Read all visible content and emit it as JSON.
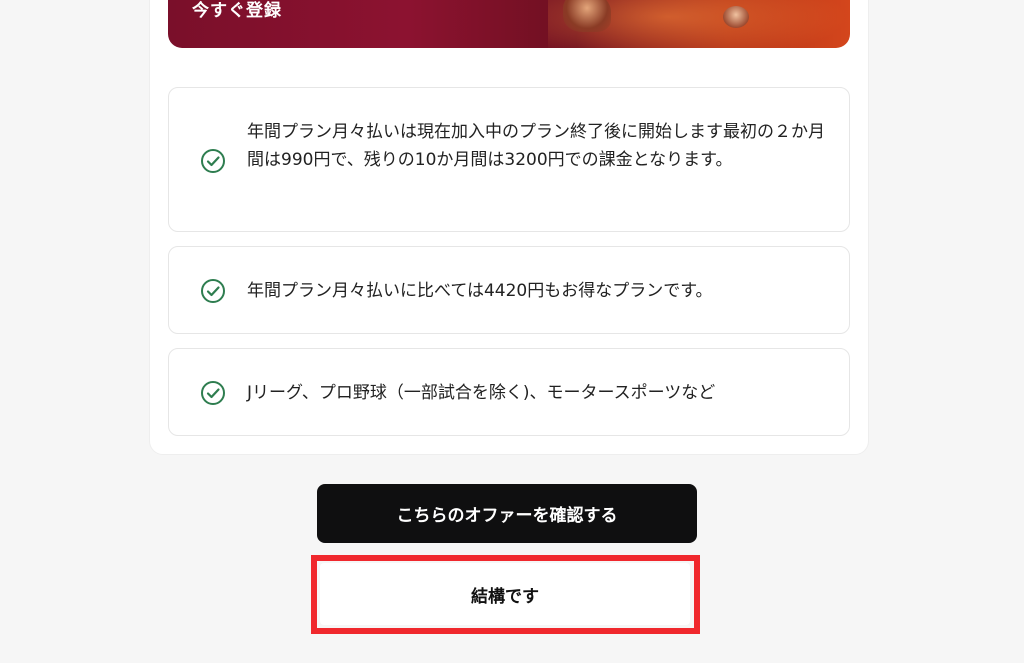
{
  "hero": {
    "register_label": "今すぐ登録"
  },
  "features": [
    {
      "icon": "check-circle-icon",
      "text": "年間プラン月々払いは現在加入中のプラン終了後に開始します最初の２か月間は990円で、残りの10か月間は3200円での課金となります。"
    },
    {
      "icon": "check-circle-icon",
      "text": "年間プラン月々払いに比べては4420円もお得なプランです。"
    },
    {
      "icon": "check-circle-icon",
      "text": "Jリーグ、プロ野球（一部試合を除く)、モータースポーツなど"
    }
  ],
  "actions": {
    "confirm_offer_label": "こちらのオファーを確認する",
    "decline_label": "結構です"
  },
  "colors": {
    "check": "#2e7d4f",
    "primary_button": "#0f0f10",
    "highlight": "#f0282d"
  }
}
